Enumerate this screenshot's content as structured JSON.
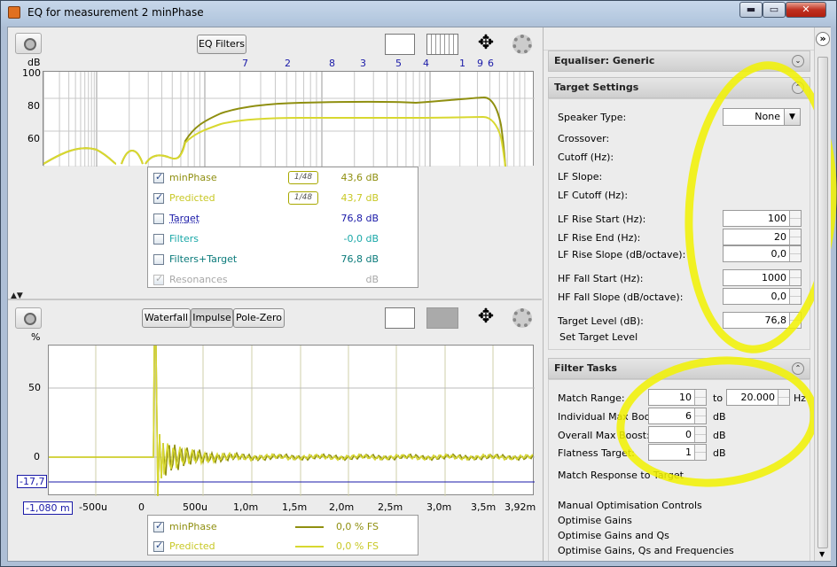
{
  "window": {
    "title": "EQ for measurement 2 minPhase",
    "btn_min": "▬",
    "btn_max": "▭",
    "btn_close": "✕"
  },
  "top_panel": {
    "eq_filters_label": "EQ Filters",
    "y_unit": "dB",
    "y_ticks": [
      "100",
      "80",
      "60"
    ],
    "filter_numbers": [
      "7",
      "2",
      "8",
      "3",
      "5",
      "4",
      "1",
      "9",
      "6"
    ],
    "legend": [
      {
        "name": "minPhase",
        "checked": true,
        "smoothing": "1/48",
        "value": "43,6 dB",
        "color": "#8f8f10"
      },
      {
        "name": "Predicted",
        "checked": true,
        "smoothing": "1/48",
        "value": "43,7 dB",
        "color": "#c8c826"
      },
      {
        "name": "Target",
        "checked": false,
        "value": "76,8 dB",
        "color": "#1a1aa8"
      },
      {
        "name": "Filters",
        "checked": false,
        "value": "-0,0 dB",
        "color": "#1aa8a8"
      },
      {
        "name": "Filters+Target",
        "checked": false,
        "value": "76,8 dB",
        "color": "#0a7a7a"
      },
      {
        "name": "Resonances",
        "checked": true,
        "disabled": true,
        "value": "dB",
        "color": "#a8a8a8"
      }
    ]
  },
  "bottom_panel": {
    "tabs": [
      "Waterfall",
      "Impulse",
      "Pole-Zero"
    ],
    "active_tab": "Impulse",
    "y_unit": "%",
    "y_ticks": [
      "50",
      "0"
    ],
    "cursor_y": "-17,7",
    "cursor_x": "-1,080 m",
    "x_ticks": [
      "-500u",
      "0",
      "500u",
      "1,0m",
      "1,5m",
      "2,0m",
      "2,5m",
      "3,0m",
      "3,5m",
      "3,92m"
    ],
    "legend": [
      {
        "name": "minPhase",
        "checked": true,
        "value": "0,0 % FS",
        "color": "#8f8f10"
      },
      {
        "name": "Predicted",
        "checked": true,
        "value": "0,0 % FS",
        "color": "#c8c826"
      }
    ]
  },
  "right_panel": {
    "expand_icon": "»",
    "equaliser_header": "Equaliser: Generic",
    "target_header": "Target Settings",
    "target_fields": {
      "speaker_type_label": "Speaker Type:",
      "speaker_type_value": "None",
      "crossover_label": "Crossover:",
      "cutoff_label": "Cutoff (Hz):",
      "lf_slope_label": "LF Slope:",
      "lf_cutoff_label": "LF Cutoff (Hz):",
      "lf_rise_start_label": "LF Rise Start (Hz):",
      "lf_rise_start_value": "100",
      "lf_rise_end_label": "LF Rise End (Hz):",
      "lf_rise_end_value": "20",
      "lf_rise_slope_label": "LF Rise Slope (dB/octave):",
      "lf_rise_slope_value": "0,0",
      "hf_fall_start_label": "HF Fall Start (Hz):",
      "hf_fall_start_value": "1000",
      "hf_fall_slope_label": "HF Fall Slope (dB/octave):",
      "hf_fall_slope_value": "0,0",
      "target_level_label": "Target Level (dB):",
      "target_level_value": "76,8",
      "set_target_level": "Set Target Level"
    },
    "filter_tasks_header": "Filter Tasks",
    "filter_tasks": {
      "match_range_label": "Match Range:",
      "match_range_from": "10",
      "to_label": "to",
      "match_range_to": "20.000",
      "hz_label": "Hz",
      "ind_max_boost_label": "Individual Max Boost:",
      "ind_max_boost_value": "6",
      "db1": "dB",
      "overall_max_boost_label": "Overall Max Boost:",
      "overall_max_boost_value": "0",
      "db2": "dB",
      "flatness_target_label": "Flatness Target:",
      "flatness_target_value": "1",
      "db3": "dB",
      "match_response": "Match Response to Target",
      "manual_opt": "Manual Optimisation Controls",
      "opt_gains": "Optimise Gains",
      "opt_gains_qs": "Optimise Gains and Qs",
      "opt_gains_qs_freq": "Optimise Gains, Qs and Frequencies"
    }
  }
}
